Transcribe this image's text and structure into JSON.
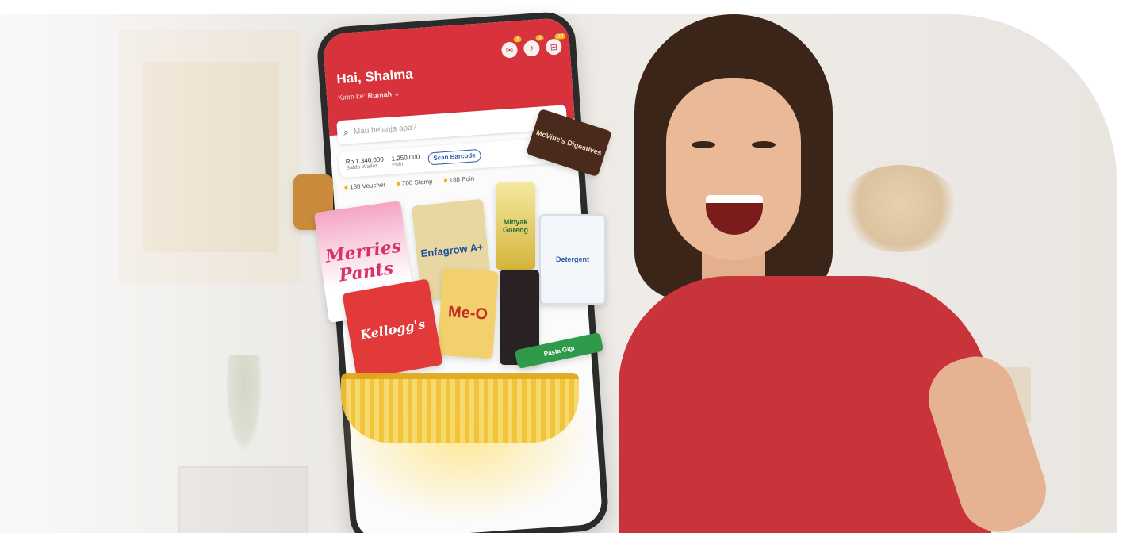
{
  "hero": {
    "colors": {
      "brand_red": "#d8323c",
      "basket_yellow": "#f2c230",
      "shirt_red": "#c8343a"
    }
  },
  "phone_app": {
    "greeting": "Hai, Shalma",
    "location_prefix": "Kirim ke:",
    "location_value": "Rumah",
    "header_icons": [
      {
        "icon": "chat-icon",
        "badge": "2"
      },
      {
        "icon": "bell-icon",
        "badge": "3"
      },
      {
        "icon": "cart-icon",
        "badge": "99"
      }
    ],
    "search_placeholder": "Mau belanja apa?",
    "stats": {
      "balance_value": "Rp 1.340.000",
      "balance_label": "Saldo Wallet",
      "points_value": "1.250.000",
      "points_label": "Poin",
      "scan_label": "Scan Barcode"
    },
    "promos": [
      "188 Voucher",
      "700 Stamp",
      "188 Poin"
    ]
  },
  "products": {
    "merries": "Merries Pants",
    "milk": "Enfagrow A+",
    "oil": "Minyak Goreng",
    "jug": "Detergent",
    "kelloggs": "Kellogg's",
    "mec": "Me-O",
    "choco": "McVitie's Digestives",
    "paste": "Pasta Gigi"
  }
}
